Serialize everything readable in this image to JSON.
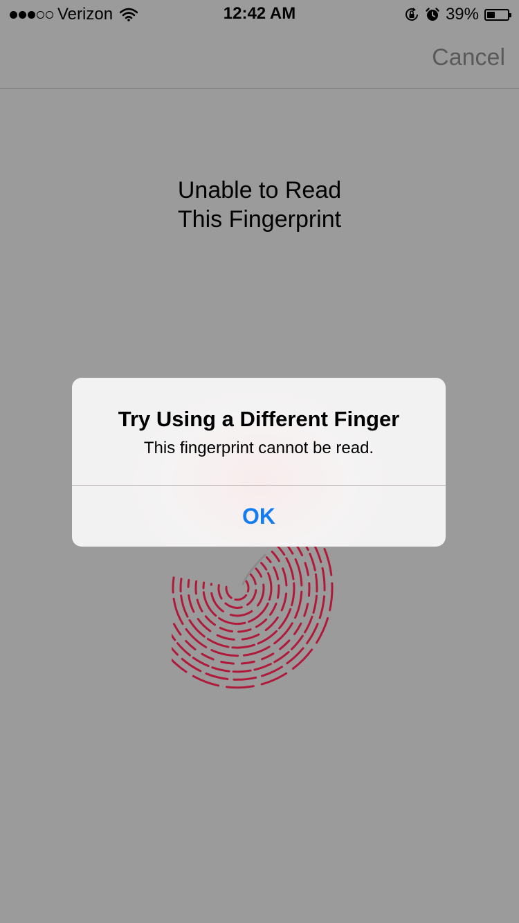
{
  "status_bar": {
    "carrier": "Verizon",
    "signal_bars_filled": 3,
    "signal_bars_total": 5,
    "time": "12:42 AM",
    "battery_percent": "39%",
    "battery_level": 0.39,
    "icons": [
      "wifi-icon",
      "rotation-lock-icon",
      "alarm-icon",
      "battery-icon"
    ]
  },
  "nav": {
    "cancel_label": "Cancel"
  },
  "instruction": {
    "line1": "Unable to Read",
    "line2": "This Fingerprint"
  },
  "fingerprint": {
    "icon": "fingerprint-icon",
    "color": "#b01a3a"
  },
  "alert": {
    "title": "Try Using a Different Finger",
    "message": "This fingerprint cannot be read.",
    "ok_label": "OK"
  },
  "colors": {
    "background": "#9b9b9b",
    "accent": "#127cf0",
    "fingerprint": "#b01a3a"
  }
}
